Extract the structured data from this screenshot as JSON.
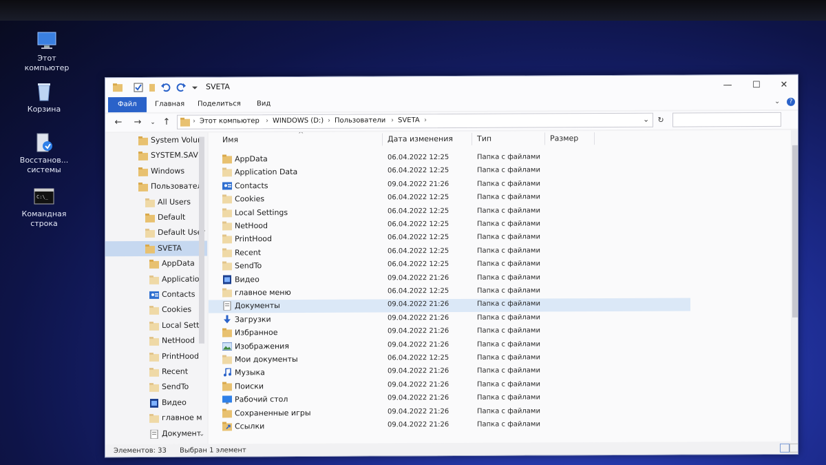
{
  "desktop": {
    "icons": [
      {
        "label": "Этот компьютер",
        "icon": "computer-icon"
      },
      {
        "label": "Корзина",
        "icon": "recycle-bin-icon"
      },
      {
        "label": "Восстанов... системы",
        "icon": "system-restore-icon"
      },
      {
        "label": "Командная строка",
        "icon": "command-prompt-icon"
      }
    ]
  },
  "window": {
    "title": "SVETA",
    "controls": {
      "minimize": "—",
      "maximize": "☐",
      "close": "✕"
    }
  },
  "ribbon": {
    "tabs": [
      "Файл",
      "Главная",
      "Поделиться",
      "Вид"
    ],
    "help": "?"
  },
  "address": {
    "crumbs": [
      "Этот компьютер",
      "WINDOWS (D:)",
      "Пользователи",
      "SVETA"
    ],
    "search_placeholder": ""
  },
  "nav_pane": {
    "items": [
      {
        "label": "System Volun",
        "icon": "folder-icon"
      },
      {
        "label": "SYSTEM.SAV",
        "icon": "folder-icon"
      },
      {
        "label": "Windows",
        "icon": "folder-icon"
      },
      {
        "label": "Пользовател",
        "icon": "folder-icon"
      },
      {
        "label": "All Users",
        "icon": "shortcut-folder-icon"
      },
      {
        "label": "Default",
        "icon": "folder-icon"
      },
      {
        "label": "Default User",
        "icon": "shortcut-folder-icon"
      },
      {
        "label": "SVETA",
        "icon": "folder-icon",
        "selected": true
      },
      {
        "label": "AppData",
        "icon": "folder-icon"
      },
      {
        "label": "Applicatio",
        "icon": "shortcut-folder-icon"
      },
      {
        "label": "Contacts",
        "icon": "contacts-icon"
      },
      {
        "label": "Cookies",
        "icon": "shortcut-folder-icon"
      },
      {
        "label": "Local Setti",
        "icon": "shortcut-folder-icon"
      },
      {
        "label": "NetHood",
        "icon": "shortcut-folder-icon"
      },
      {
        "label": "PrintHood",
        "icon": "shortcut-folder-icon"
      },
      {
        "label": "Recent",
        "icon": "shortcut-folder-icon"
      },
      {
        "label": "SendTo",
        "icon": "shortcut-folder-icon"
      },
      {
        "label": "Видео",
        "icon": "video-icon"
      },
      {
        "label": "главное м",
        "icon": "shortcut-folder-icon"
      },
      {
        "label": "Документ",
        "icon": "documents-icon"
      }
    ]
  },
  "file_list": {
    "columns": [
      "Имя",
      "Дата изменения",
      "Тип",
      "Размер"
    ],
    "sort_indicator": "^",
    "rows": [
      {
        "name": "AppData",
        "date": "06.04.2022 12:25",
        "type": "Папка с файлами",
        "icon": "folder-icon"
      },
      {
        "name": "Application Data",
        "date": "06.04.2022 12:25",
        "type": "Папка с файлами",
        "icon": "shortcut-folder-icon"
      },
      {
        "name": "Contacts",
        "date": "09.04.2022 21:26",
        "type": "Папка с файлами",
        "icon": "contacts-icon"
      },
      {
        "name": "Cookies",
        "date": "06.04.2022 12:25",
        "type": "Папка с файлами",
        "icon": "shortcut-folder-icon"
      },
      {
        "name": "Local Settings",
        "date": "06.04.2022 12:25",
        "type": "Папка с файлами",
        "icon": "shortcut-folder-icon"
      },
      {
        "name": "NetHood",
        "date": "06.04.2022 12:25",
        "type": "Папка с файлами",
        "icon": "shortcut-folder-icon"
      },
      {
        "name": "PrintHood",
        "date": "06.04.2022 12:25",
        "type": "Папка с файлами",
        "icon": "shortcut-folder-icon"
      },
      {
        "name": "Recent",
        "date": "06.04.2022 12:25",
        "type": "Папка с файлами",
        "icon": "shortcut-folder-icon"
      },
      {
        "name": "SendTo",
        "date": "06.04.2022 12:25",
        "type": "Папка с файлами",
        "icon": "shortcut-folder-icon"
      },
      {
        "name": "Видео",
        "date": "09.04.2022 21:26",
        "type": "Папка с файлами",
        "icon": "video-icon"
      },
      {
        "name": "главное меню",
        "date": "06.04.2022 12:25",
        "type": "Папка с файлами",
        "icon": "shortcut-folder-icon"
      },
      {
        "name": "Документы",
        "date": "09.04.2022 21:26",
        "type": "Папка с файлами",
        "icon": "documents-icon",
        "selected": true
      },
      {
        "name": "Загрузки",
        "date": "09.04.2022 21:26",
        "type": "Папка с файлами",
        "icon": "downloads-icon"
      },
      {
        "name": "Избранное",
        "date": "09.04.2022 21:26",
        "type": "Папка с файлами",
        "icon": "folder-icon"
      },
      {
        "name": "Изображения",
        "date": "09.04.2022 21:26",
        "type": "Папка с файлами",
        "icon": "pictures-icon"
      },
      {
        "name": "Мои документы",
        "date": "06.04.2022 12:25",
        "type": "Папка с файлами",
        "icon": "shortcut-folder-icon"
      },
      {
        "name": "Музыка",
        "date": "09.04.2022 21:26",
        "type": "Папка с файлами",
        "icon": "music-icon"
      },
      {
        "name": "Поиски",
        "date": "09.04.2022 21:26",
        "type": "Папка с файлами",
        "icon": "folder-icon"
      },
      {
        "name": "Рабочий стол",
        "date": "09.04.2022 21:26",
        "type": "Папка с файлами",
        "icon": "desktop-folder-icon"
      },
      {
        "name": "Сохраненные игры",
        "date": "09.04.2022 21:26",
        "type": "Папка с файлами",
        "icon": "folder-icon"
      },
      {
        "name": "Ссылки",
        "date": "09.04.2022 21:26",
        "type": "Папка с файлами",
        "icon": "links-icon"
      }
    ]
  },
  "status": {
    "count": "Элементов: 33",
    "selection": "Выбран 1 элемент"
  },
  "colors": {
    "accent": "#2a62c9",
    "selection": "#c6d8f0",
    "folder": "#e8c170"
  }
}
